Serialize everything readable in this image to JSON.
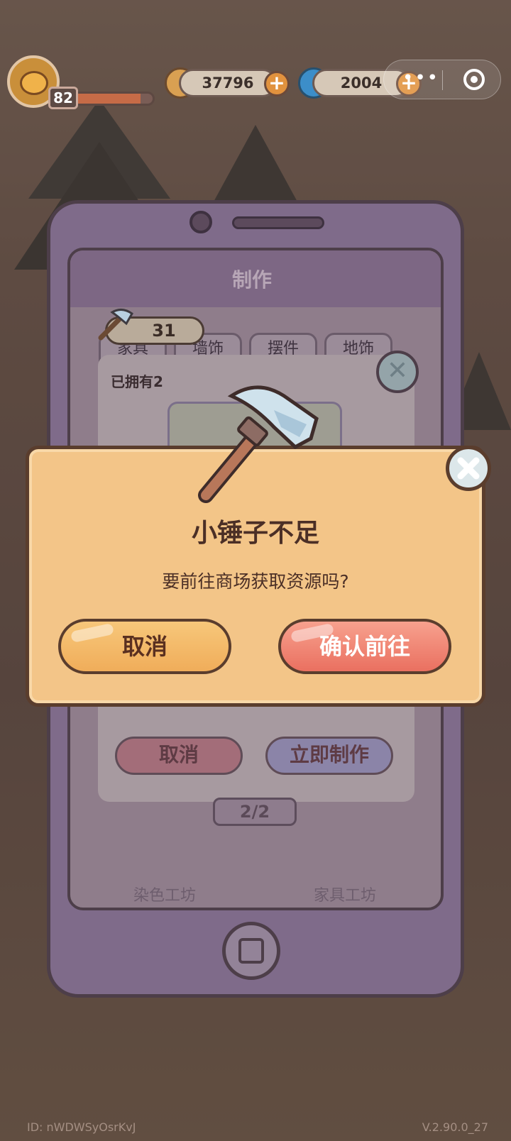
{
  "player": {
    "level": "82",
    "xp_fraction": 0.85
  },
  "resources": {
    "coins": {
      "value": "37796",
      "icon": "coin-icon"
    },
    "gems": {
      "value": "2004",
      "icon": "swirl-icon"
    }
  },
  "workshop": {
    "title": "制作",
    "tabs": [
      "家具",
      "墙饰",
      "摆件",
      "地饰"
    ],
    "hammer_count": "31",
    "owned_label": "已拥有2",
    "cancel_label": "取消",
    "craft_label": "立即制作",
    "pager": "2/2",
    "nav": [
      "染色工坊",
      "家具工坊"
    ]
  },
  "dialog": {
    "title": "小锤子不足",
    "message": "要前往商场获取资源吗?",
    "cancel": "取消",
    "confirm": "确认前往"
  },
  "footer": {
    "id": "ID: nWDWSyOsrKvJ",
    "version": "V.2.90.0_27"
  },
  "colors": {
    "dialog_bg": "#f3c588",
    "confirm": "#ea7060",
    "cancel": "#f0ad5a"
  }
}
